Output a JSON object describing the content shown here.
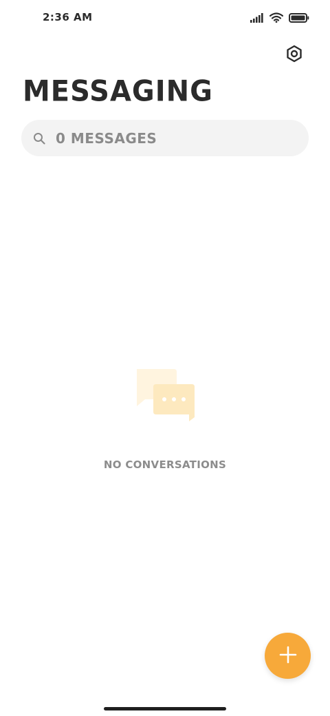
{
  "status_bar": {
    "time": "2:36 AM",
    "icons": [
      "signal-icon",
      "wifi-icon",
      "battery-icon"
    ]
  },
  "header": {
    "title": "MESSAGING",
    "settings_icon": "settings-icon"
  },
  "search": {
    "icon": "search-icon",
    "placeholder": "0 MESSAGES"
  },
  "empty_state": {
    "icon": "chat-bubbles-icon",
    "text": "NO CONVERSATIONS"
  },
  "fab": {
    "icon": "plus-icon"
  },
  "colors": {
    "accent": "#f7a93a",
    "title_text": "#2b2b2b",
    "muted_text": "#8c8c8c",
    "search_bg": "#f3f3f3",
    "illustration": "#fde9bf"
  }
}
